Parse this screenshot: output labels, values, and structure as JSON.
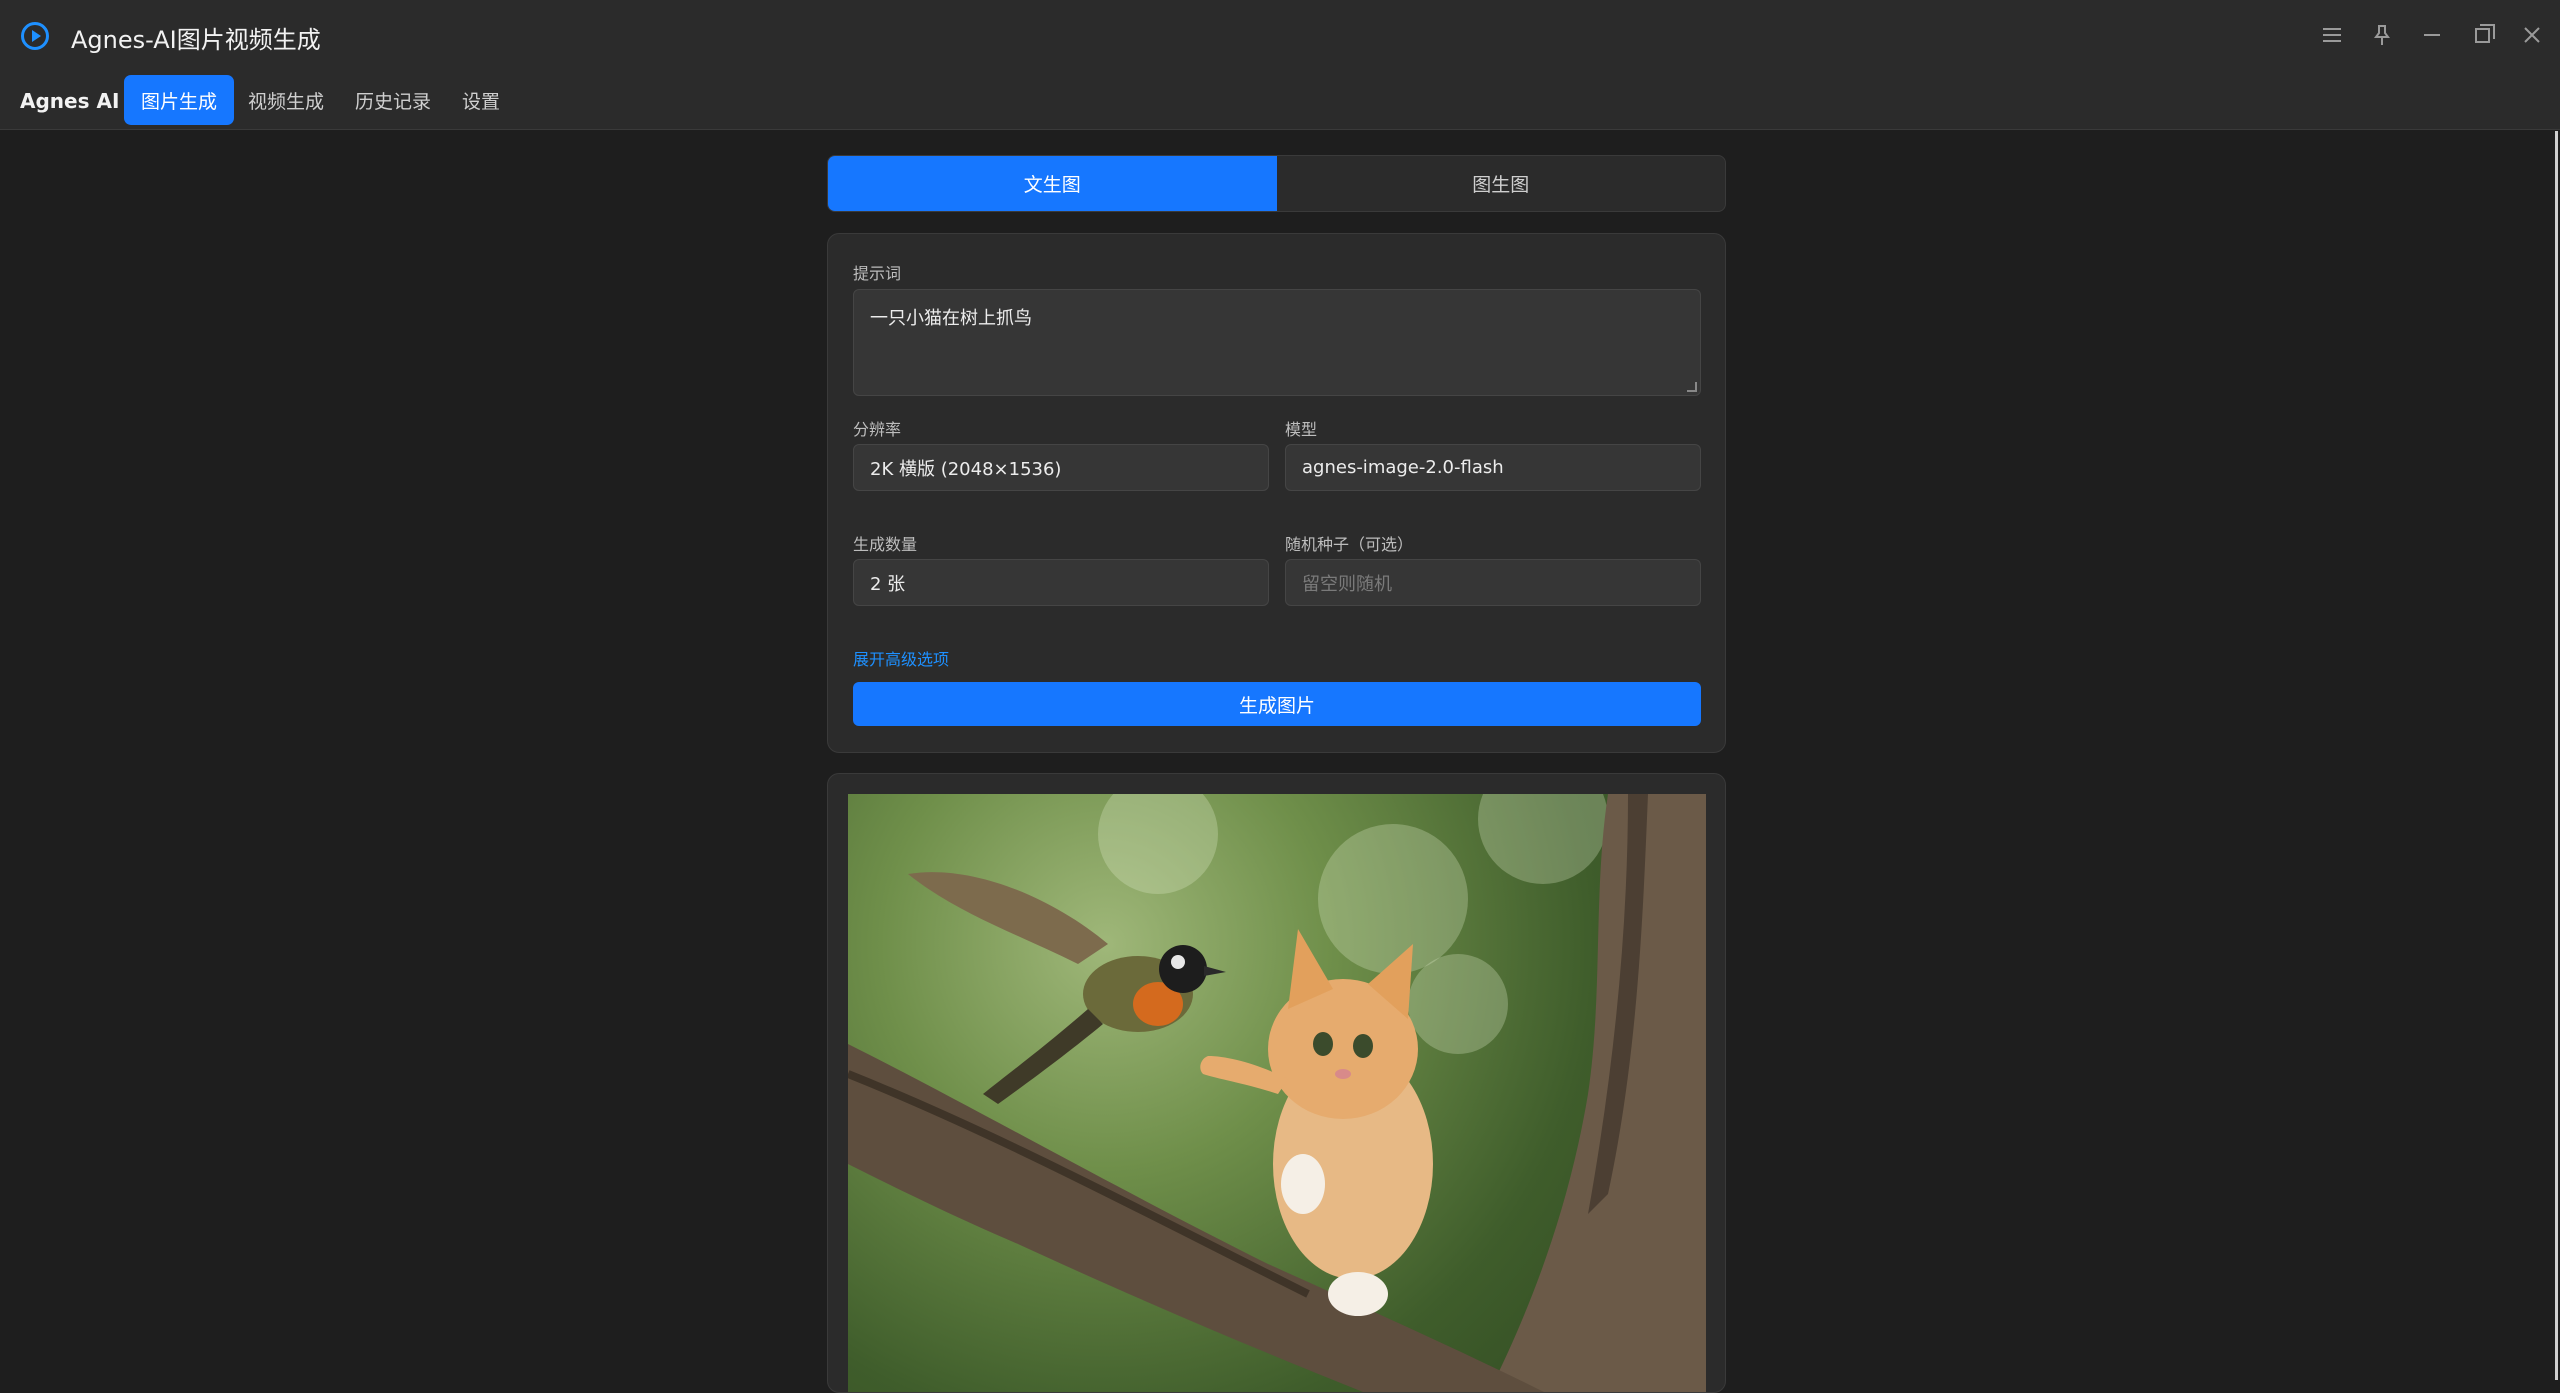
{
  "titlebar": {
    "title": "Agnes-AI图片视频生成",
    "icons": [
      "menu-icon",
      "pin-icon",
      "minimize-icon",
      "restore-icon",
      "close-icon"
    ]
  },
  "navbar": {
    "brand": "Agnes AI",
    "tabs": [
      {
        "label": "图片生成",
        "active": true
      },
      {
        "label": "视频生成",
        "active": false
      },
      {
        "label": "历史记录",
        "active": false
      },
      {
        "label": "设置",
        "active": false
      }
    ]
  },
  "mode_tabs": [
    {
      "label": "文生图",
      "active": true
    },
    {
      "label": "图生图",
      "active": false
    }
  ],
  "form": {
    "prompt_label": "提示词",
    "prompt_value": "一只小猫在树上抓鸟",
    "resolution_label": "分辨率",
    "resolution_value": "2K 横版 (2048×1536)",
    "model_label": "模型",
    "model_value": "agnes-image-2.0-flash",
    "count_label": "生成数量",
    "count_value": "2 张",
    "seed_label": "随机种子（可选）",
    "seed_placeholder": "留空则随机",
    "advanced_link": "展开高级选项",
    "generate_button": "生成图片"
  },
  "colors": {
    "accent": "#1677ff",
    "background": "#1e1e1e",
    "panel": "#2b2b2b"
  }
}
